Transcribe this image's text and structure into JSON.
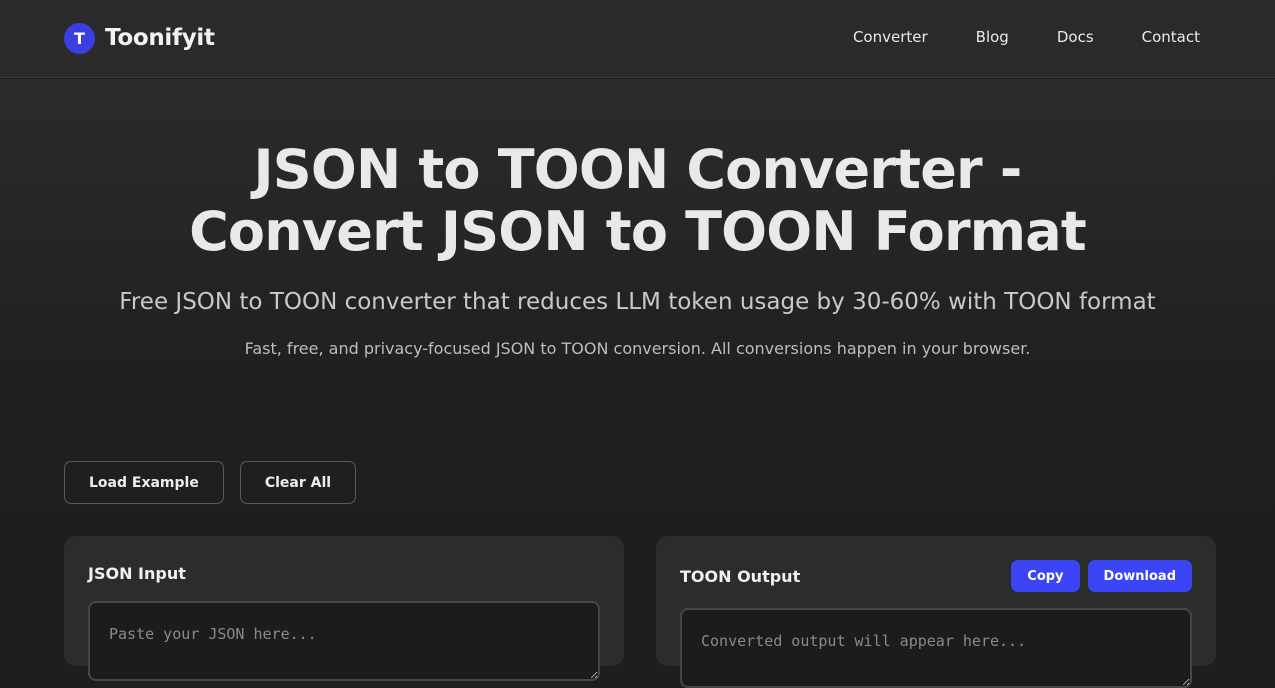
{
  "brand": {
    "logo_letter": "T",
    "name": "Toonifyit"
  },
  "nav": {
    "items": [
      "Converter",
      "Blog",
      "Docs",
      "Contact"
    ]
  },
  "hero": {
    "title_line1": "JSON to TOON Converter -",
    "title_line2": "Convert JSON to TOON Format",
    "subtitle": "Free JSON to TOON converter that reduces LLM token usage by 30-60% with TOON format",
    "description": "Fast, free, and privacy-focused JSON to TOON conversion. All conversions happen in your browser."
  },
  "actions": {
    "load_example": "Load Example",
    "clear_all": "Clear All"
  },
  "input_panel": {
    "title": "JSON Input",
    "placeholder": "Paste your JSON here..."
  },
  "output_panel": {
    "title": "TOON Output",
    "placeholder": "Converted output will appear here...",
    "copy": "Copy",
    "download": "Download"
  },
  "colors": {
    "accent": "#3b45f5",
    "logo": "#3b3fe0",
    "background": "#1e1e1e"
  }
}
